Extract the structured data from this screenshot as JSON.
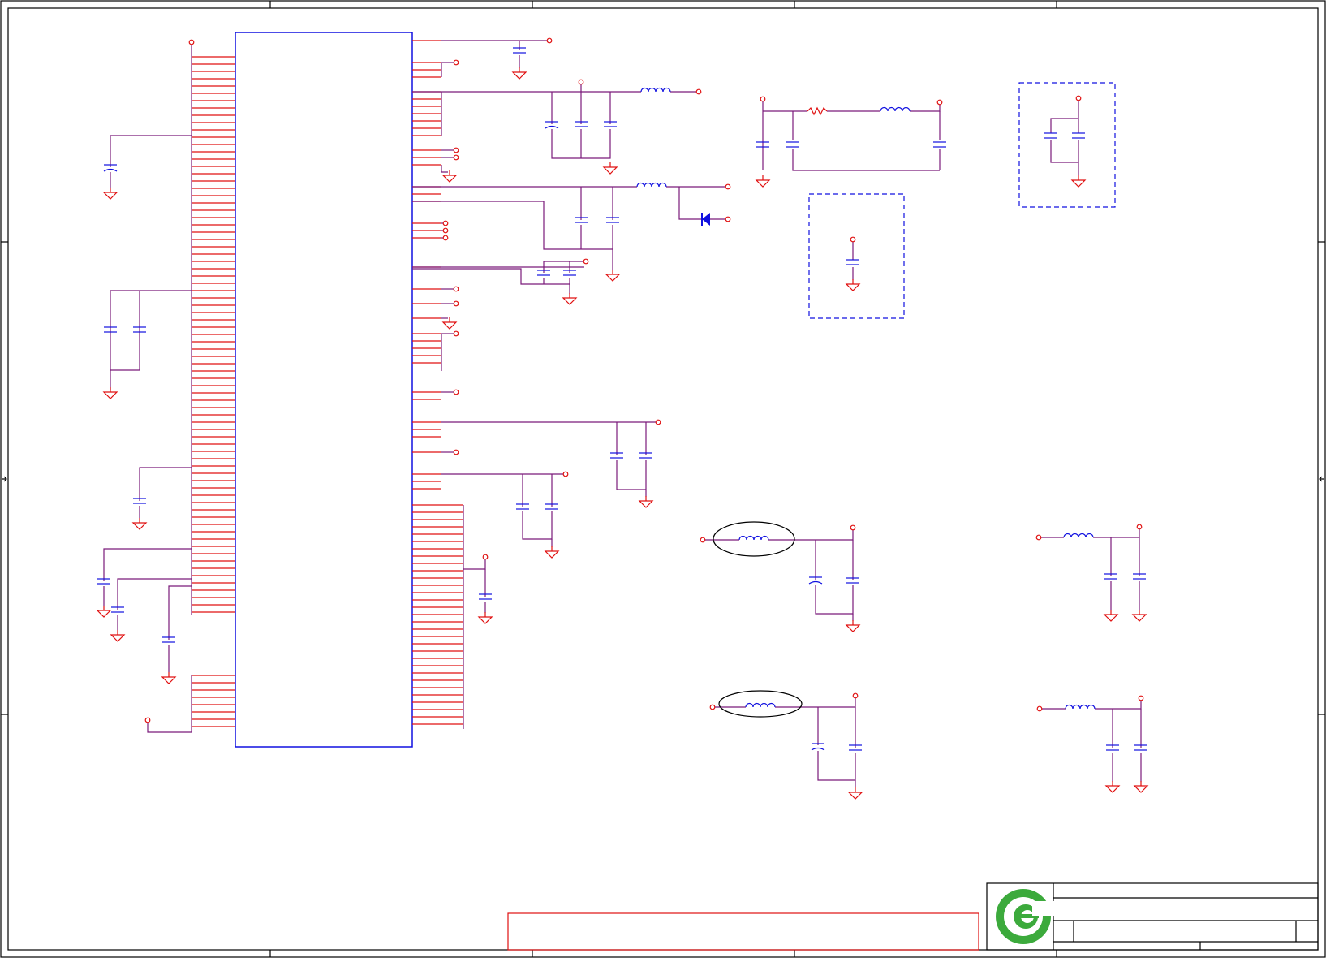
{
  "colors": {
    "wire": "#7a1a7a",
    "pin": "#e01010",
    "part": "#1010e0",
    "frame": "#000000",
    "logo": "#3caa3c"
  },
  "icons": {
    "logo": "company-logo-icon"
  }
}
